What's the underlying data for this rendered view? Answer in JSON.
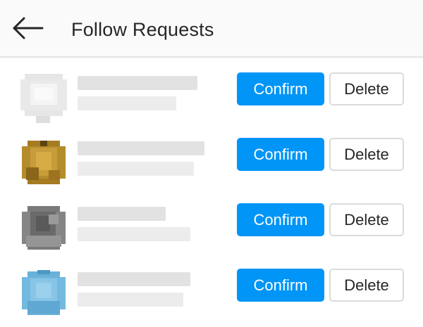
{
  "header": {
    "title": "Follow Requests",
    "back_icon": "arrow-left-icon"
  },
  "colors": {
    "accent": "#0095f6",
    "header_bg": "#fafafa",
    "text": "#262626",
    "border": "#dbdbdb"
  },
  "requests": [
    {
      "avatar_color": "#dddddd",
      "confirm_label": "Confirm",
      "delete_label": "Delete"
    },
    {
      "avatar_color": "#b8902e",
      "confirm_label": "Confirm",
      "delete_label": "Delete"
    },
    {
      "avatar_color": "#7d7d7d",
      "confirm_label": "Confirm",
      "delete_label": "Delete"
    },
    {
      "avatar_color": "#6fb4dc",
      "confirm_label": "Confirm",
      "delete_label": "Delete"
    }
  ]
}
